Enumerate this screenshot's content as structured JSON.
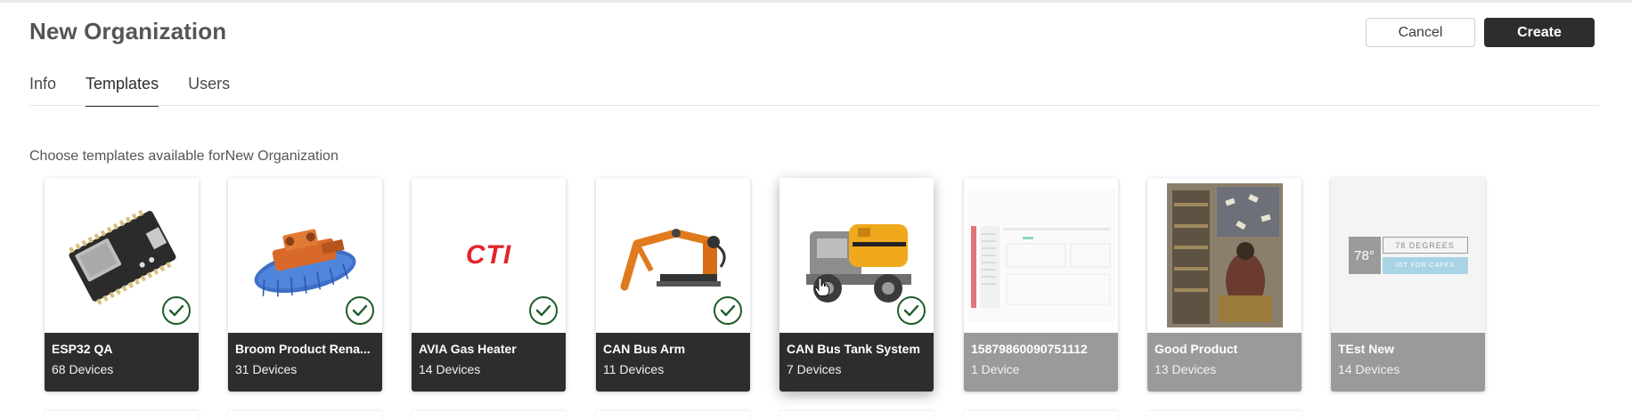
{
  "header": {
    "title": "New Organization",
    "cancel_label": "Cancel",
    "create_label": "Create"
  },
  "tabs": [
    {
      "label": "Info",
      "active": false
    },
    {
      "label": "Templates",
      "active": true
    },
    {
      "label": "Users",
      "active": false
    }
  ],
  "subtitle": "Choose templates available forNew Organization",
  "templates": [
    {
      "name": "ESP32 QA",
      "devices": "68 Devices",
      "selected": true,
      "image": "esp32-board"
    },
    {
      "name": "Broom Product Rena...",
      "devices": "31 Devices",
      "selected": true,
      "image": "broom-machine"
    },
    {
      "name": "AVIA Gas Heater",
      "devices": "14 Devices",
      "selected": true,
      "image": "cti-logo"
    },
    {
      "name": "CAN Bus Arm",
      "devices": "11 Devices",
      "selected": true,
      "image": "hydraulic-arm"
    },
    {
      "name": "CAN Bus Tank System",
      "devices": "7 Devices",
      "selected": true,
      "image": "tank-truck"
    },
    {
      "name": "15879860090751112",
      "devices": "1 Device",
      "selected": false,
      "image": "screenshot-thumbnail"
    },
    {
      "name": "Good Product",
      "devices": "13 Devices",
      "selected": false,
      "image": "library-painting"
    },
    {
      "name": "TEst New",
      "devices": "14 Devices",
      "selected": false,
      "image": "78-degrees-logo"
    }
  ],
  "logos": {
    "cti": "CTI",
    "degrees_number": "78°",
    "degrees_title": "78 DEGREES",
    "degrees_sub": "IOT FOR CAFES"
  },
  "colors": {
    "primary": "#2f2d2c",
    "check": "#1f5c2a",
    "disabled_footer": "#9a9a9a"
  }
}
